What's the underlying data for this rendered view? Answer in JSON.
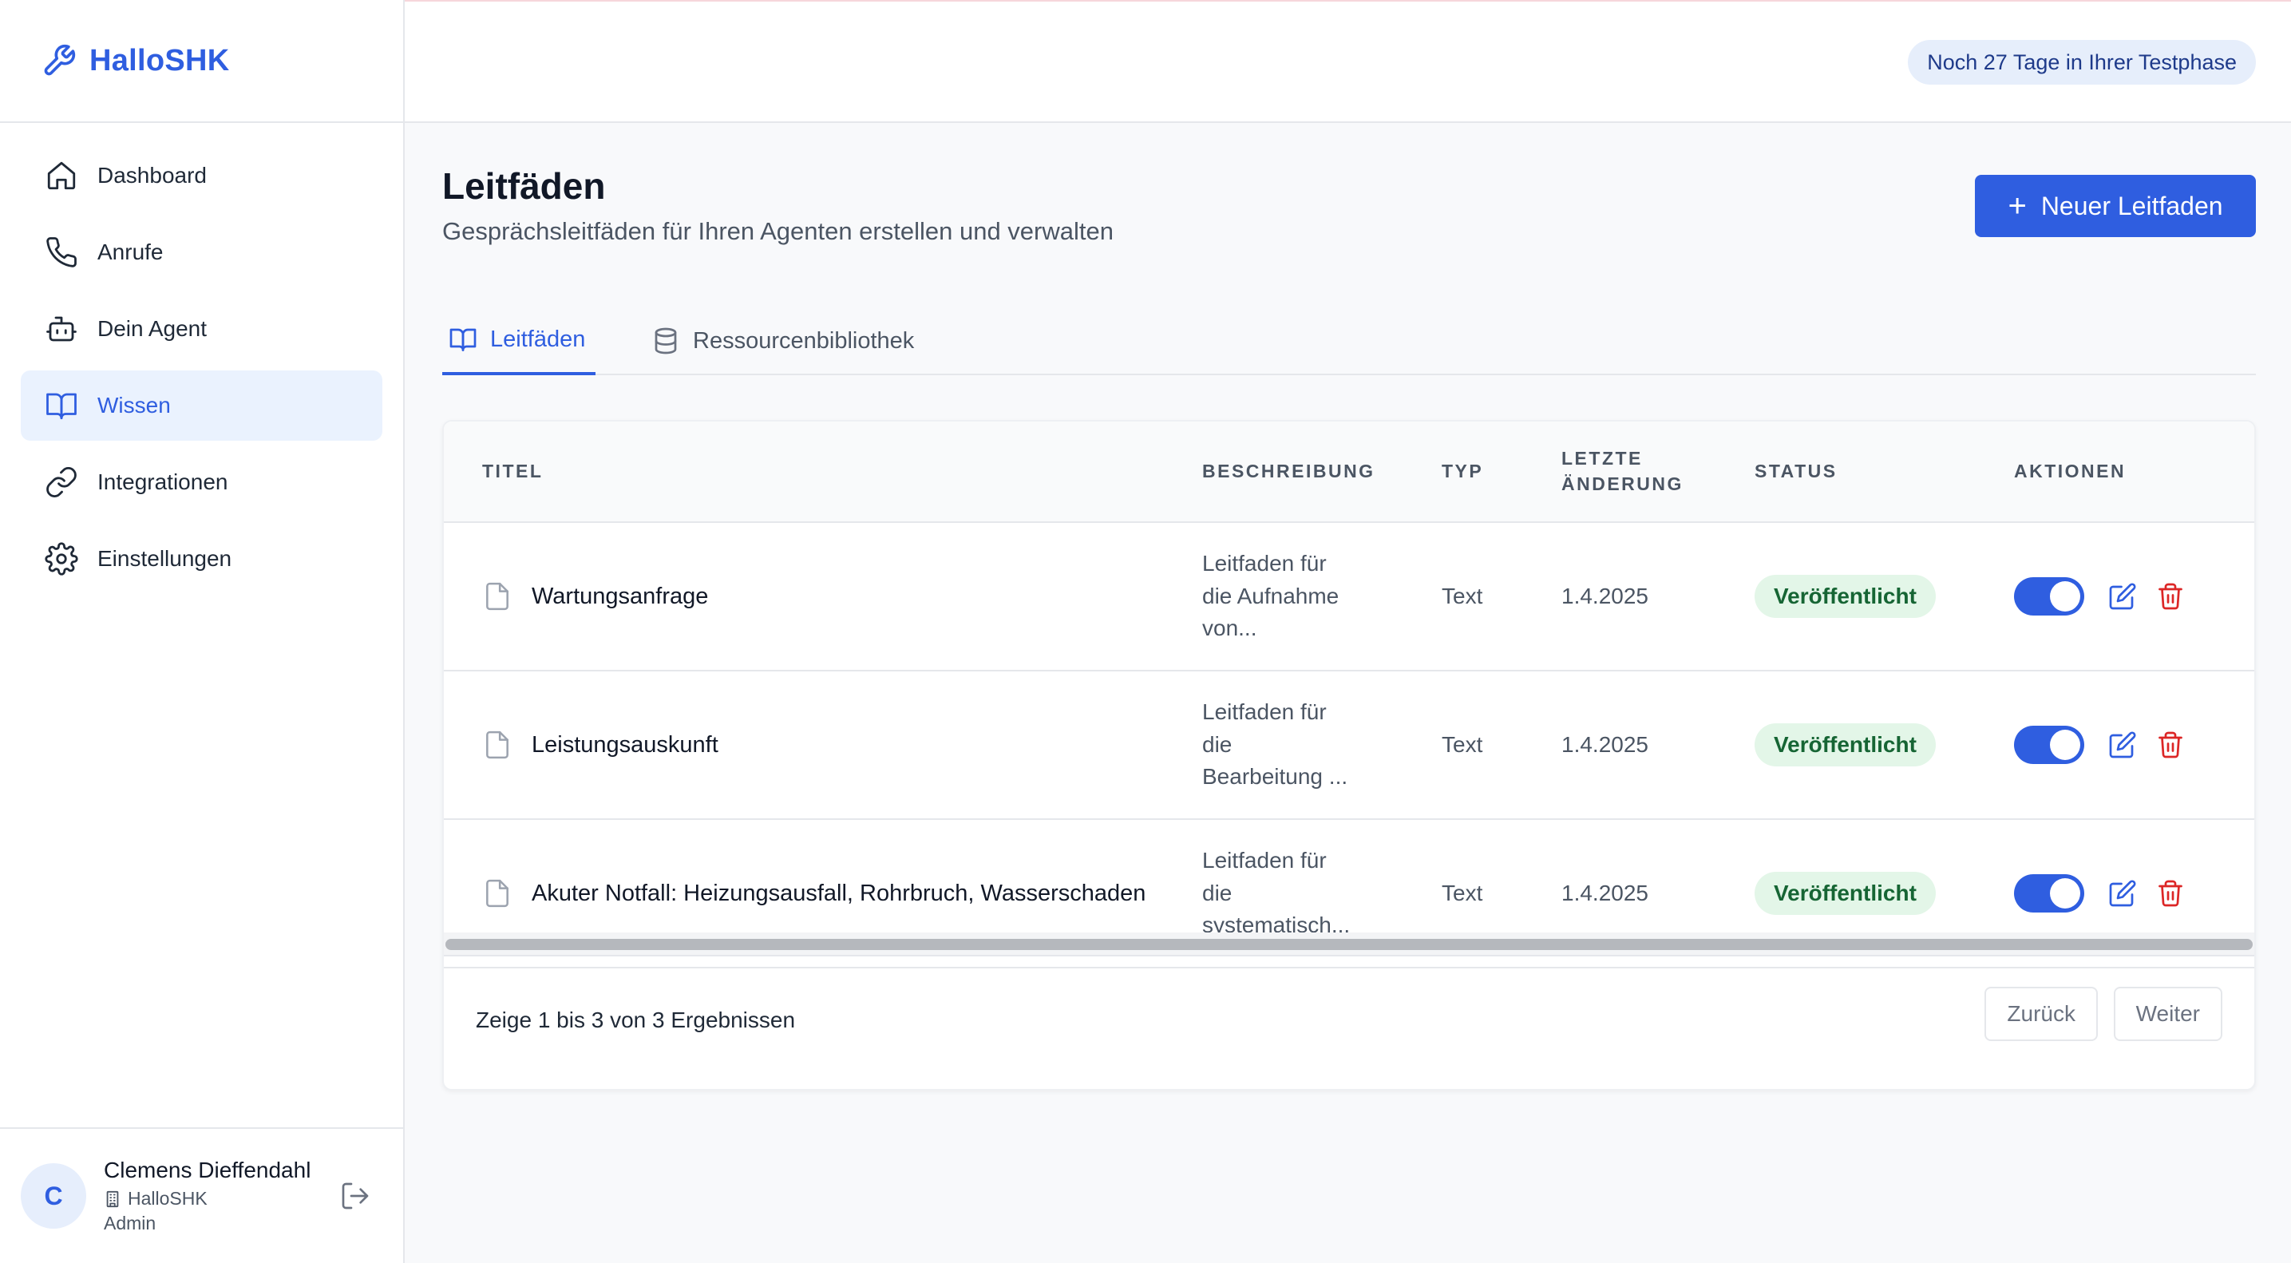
{
  "app": {
    "brand": "HalloSHK"
  },
  "sidebar": {
    "items": [
      {
        "label": "Dashboard",
        "icon": "home-icon"
      },
      {
        "label": "Anrufe",
        "icon": "phone-icon"
      },
      {
        "label": "Dein Agent",
        "icon": "bot-icon"
      },
      {
        "label": "Wissen",
        "icon": "book-icon",
        "active": true
      },
      {
        "label": "Integrationen",
        "icon": "link-icon"
      },
      {
        "label": "Einstellungen",
        "icon": "gear-icon"
      }
    ],
    "user": {
      "initial": "C",
      "name": "Clemens Dieffendahl",
      "org": "HalloSHK",
      "role": "Admin"
    }
  },
  "header": {
    "trial": "Noch 27 Tage in Ihrer Testphase"
  },
  "page": {
    "title": "Leitfäden",
    "subtitle": "Gesprächsleitfäden für Ihren Agenten erstellen und verwalten",
    "new_button": "Neuer Leitfaden",
    "tabs": [
      {
        "label": "Leitfäden",
        "active": true
      },
      {
        "label": "Ressourcenbibliothek",
        "active": false
      }
    ]
  },
  "table": {
    "headers": {
      "title": "TITEL",
      "description": "BESCHREIBUNG",
      "type": "TYP",
      "date_line1": "LETZTE",
      "date_line2": "ÄNDERUNG",
      "status": "STATUS",
      "actions": "AKTIONEN"
    },
    "rows": [
      {
        "title": "Wartungsanfrage",
        "desc1": "Leitfaden für",
        "desc2": "die Aufnahme",
        "desc3": "von...",
        "type": "Text",
        "date": "1.4.2025",
        "status": "Veröffentlicht",
        "enabled": true
      },
      {
        "title": "Leistungsauskunft",
        "desc1": "Leitfaden für",
        "desc2": "die",
        "desc3": "Bearbeitung ...",
        "type": "Text",
        "date": "1.4.2025",
        "status": "Veröffentlicht",
        "enabled": true
      },
      {
        "title": "Akuter Notfall: Heizungsausfall, Rohrbruch, Wasserschaden",
        "desc1": "Leitfaden für",
        "desc2": "die",
        "desc3": "systematisch...",
        "type": "Text",
        "date": "1.4.2025",
        "status": "Veröffentlicht",
        "enabled": true
      }
    ],
    "footer": {
      "results": "Zeige 1 bis 3 von 3 Ergebnissen",
      "back": "Zurück",
      "next": "Weiter"
    }
  },
  "colors": {
    "accent": "#2f5ee0",
    "success_bg": "#e3f6e8",
    "success_text": "#166534",
    "danger": "#dc2626"
  }
}
